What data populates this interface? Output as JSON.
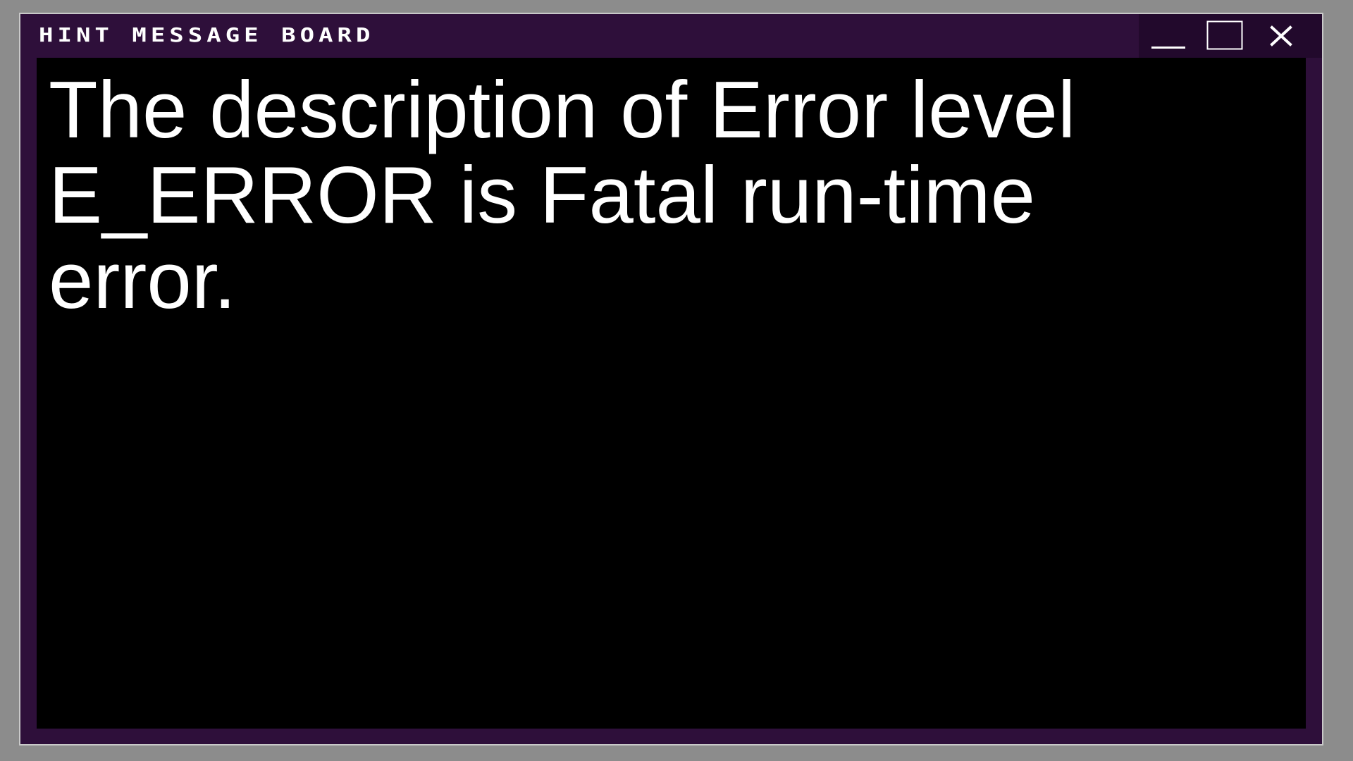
{
  "window": {
    "title": "Hint Message Board",
    "controls": {
      "minimize": "minimize-icon",
      "maximize": "maximize-icon",
      "close": "close-icon"
    }
  },
  "message": {
    "text": "The description of Error level E_ERROR is Fatal run-time error."
  },
  "colors": {
    "frame": "#2e0f3a",
    "controls_bg": "#22092c",
    "content_bg": "#000000",
    "text": "#ffffff",
    "desktop": "#8e8e8e"
  }
}
